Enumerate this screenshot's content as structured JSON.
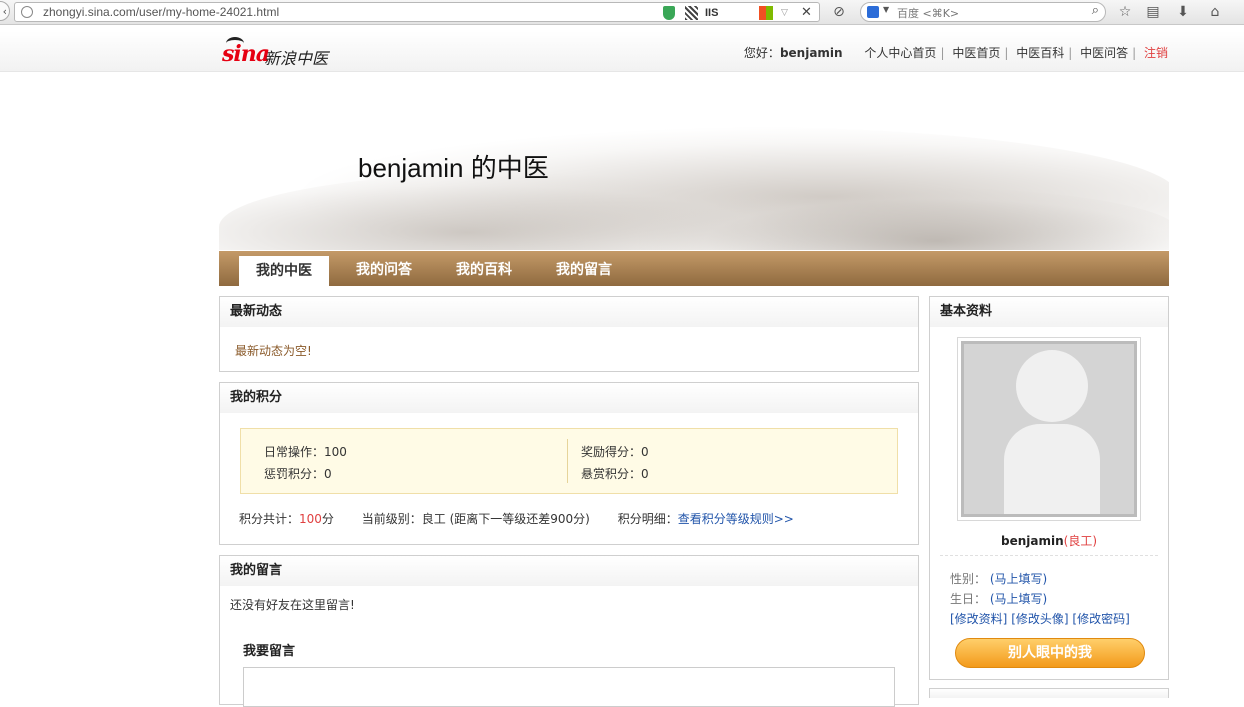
{
  "browser": {
    "url": "zhongyi.sina.com/user/my-home-24021.html",
    "search_placeholder": "百度 <⌘K>",
    "ext_iis": "IIS"
  },
  "site": {
    "logo_mark": "sina",
    "logo_text": "新浪中医",
    "greeting": "您好：",
    "username": "benjamin",
    "nav": [
      "个人中心首页",
      "中医首页",
      "中医百科",
      "中医问答"
    ],
    "logout": "注销"
  },
  "banner": {
    "title": "benjamin 的中医"
  },
  "tabs": [
    "我的中医",
    "我的问答",
    "我的百科",
    "我的留言"
  ],
  "feed": {
    "title": "最新动态",
    "empty": "最新动态为空!"
  },
  "points": {
    "title": "我的积分",
    "daily": "日常操作：100",
    "penalty": "惩罚积分：0",
    "reward": "奖励得分：0",
    "bounty": "悬赏积分：0",
    "total_label": "积分共计：",
    "total_value": "100",
    "total_unit": "分",
    "level_label": "当前级别：",
    "level_value": "良工 (距离下一等级还差900分)",
    "detail_label": "积分明细：",
    "detail_link": "查看积分等级规则>>"
  },
  "messages": {
    "title": "我的留言",
    "empty": "还没有好友在这里留言!",
    "compose_title": "我要留言"
  },
  "profile": {
    "title": "基本资料",
    "name": "benjamin",
    "rank": "(良工)",
    "gender_label": "性别：",
    "gender_value": "(马上填写)",
    "birthday_label": "生日：",
    "birthday_value": "(马上填写)",
    "edit_info": "[修改资料]",
    "edit_avatar": "[修改头像]",
    "edit_password": "[修改密码]",
    "others_view": "别人眼中的我"
  }
}
